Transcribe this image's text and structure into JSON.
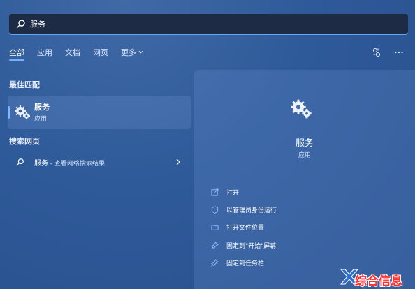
{
  "search": {
    "value": "服务",
    "placeholder": ""
  },
  "tabs": [
    {
      "label": "全部",
      "active": true
    },
    {
      "label": "应用"
    },
    {
      "label": "文档"
    },
    {
      "label": "网页"
    },
    {
      "label": "更多"
    }
  ],
  "left": {
    "best_match_title": "最佳匹配",
    "best_match": {
      "name": "服务",
      "type": "应用"
    },
    "web_title": "搜索网页",
    "web_result": {
      "query": "服务",
      "sep": " - ",
      "hint": "查看网络搜索结果"
    }
  },
  "right": {
    "title": "服务",
    "subtitle": "应用",
    "actions": [
      {
        "label": "打开",
        "icon": "open-icon"
      },
      {
        "label": "以管理员身份运行",
        "icon": "shield-icon"
      },
      {
        "label": "打开文件位置",
        "icon": "folder-icon"
      },
      {
        "label": "固定到\"开始\"屏幕",
        "icon": "pin-icon"
      },
      {
        "label": "固定到任务栏",
        "icon": "pin-icon"
      }
    ]
  },
  "watermark": {
    "text": "综合信息"
  },
  "colors": {
    "accent": "#6fb2ff",
    "watermark": "#ff2d2d"
  }
}
